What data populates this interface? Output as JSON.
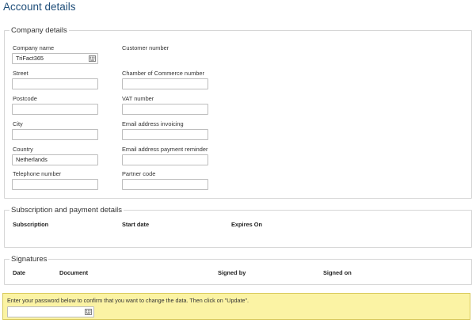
{
  "page": {
    "title": "Account details"
  },
  "company": {
    "legend": "Company details",
    "company_name": {
      "label": "Company name",
      "value": "TriFact365"
    },
    "customer_number": {
      "label": "Customer number"
    },
    "street": {
      "label": "Street",
      "value": ""
    },
    "chamber": {
      "label": "Chamber of Commerce number",
      "value": ""
    },
    "postcode": {
      "label": "Postcode",
      "value": ""
    },
    "vat": {
      "label": "VAT number",
      "value": ""
    },
    "city": {
      "label": "City",
      "value": ""
    },
    "email_invoicing": {
      "label": "Email address invoicing",
      "value": ""
    },
    "country": {
      "label": "Country",
      "value": "Netherlands"
    },
    "email_reminder": {
      "label": "Email address payment reminder",
      "value": ""
    },
    "telephone": {
      "label": "Telephone number",
      "value": ""
    },
    "partner_code": {
      "label": "Partner code",
      "value": ""
    }
  },
  "subscription": {
    "legend": "Subscription and payment details",
    "columns": [
      "Subscription",
      "Start date",
      "Expires On"
    ]
  },
  "signatures": {
    "legend": "Signatures",
    "columns": [
      "Date",
      "Document",
      "Signed by",
      "Signed on"
    ]
  },
  "confirm": {
    "text": "Enter your password below to confirm that you want to change the data. Then click on \"Update\".",
    "password_value": ""
  },
  "icons": {
    "field_icon": "keyboard-icon"
  }
}
